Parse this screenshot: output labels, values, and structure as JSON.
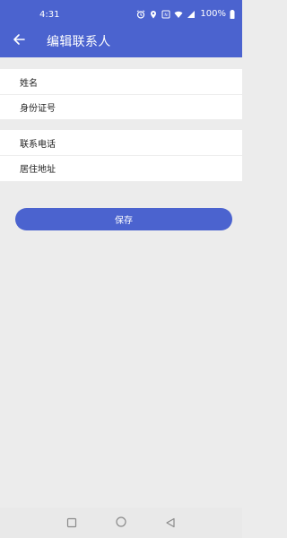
{
  "status_bar": {
    "time": "4:31",
    "battery": "100%",
    "icons": [
      "alarm-icon",
      "location-icon",
      "nfc-icon",
      "wifi-icon",
      "signal-icon",
      "battery-icon"
    ]
  },
  "app_bar": {
    "title": "编辑联系人",
    "back_icon": "arrow-left-icon"
  },
  "form": {
    "group1": [
      {
        "label": "姓名"
      },
      {
        "label": "身份证号"
      }
    ],
    "group2": [
      {
        "label": "联系电话"
      },
      {
        "label": "居住地址"
      }
    ]
  },
  "actions": {
    "save_label": "保存"
  },
  "nav": {
    "icons": [
      "recent-apps-icon",
      "home-icon",
      "back-icon"
    ]
  },
  "colors": {
    "primary": "#4b63cf",
    "background": "#ececec",
    "surface": "#ffffff"
  }
}
